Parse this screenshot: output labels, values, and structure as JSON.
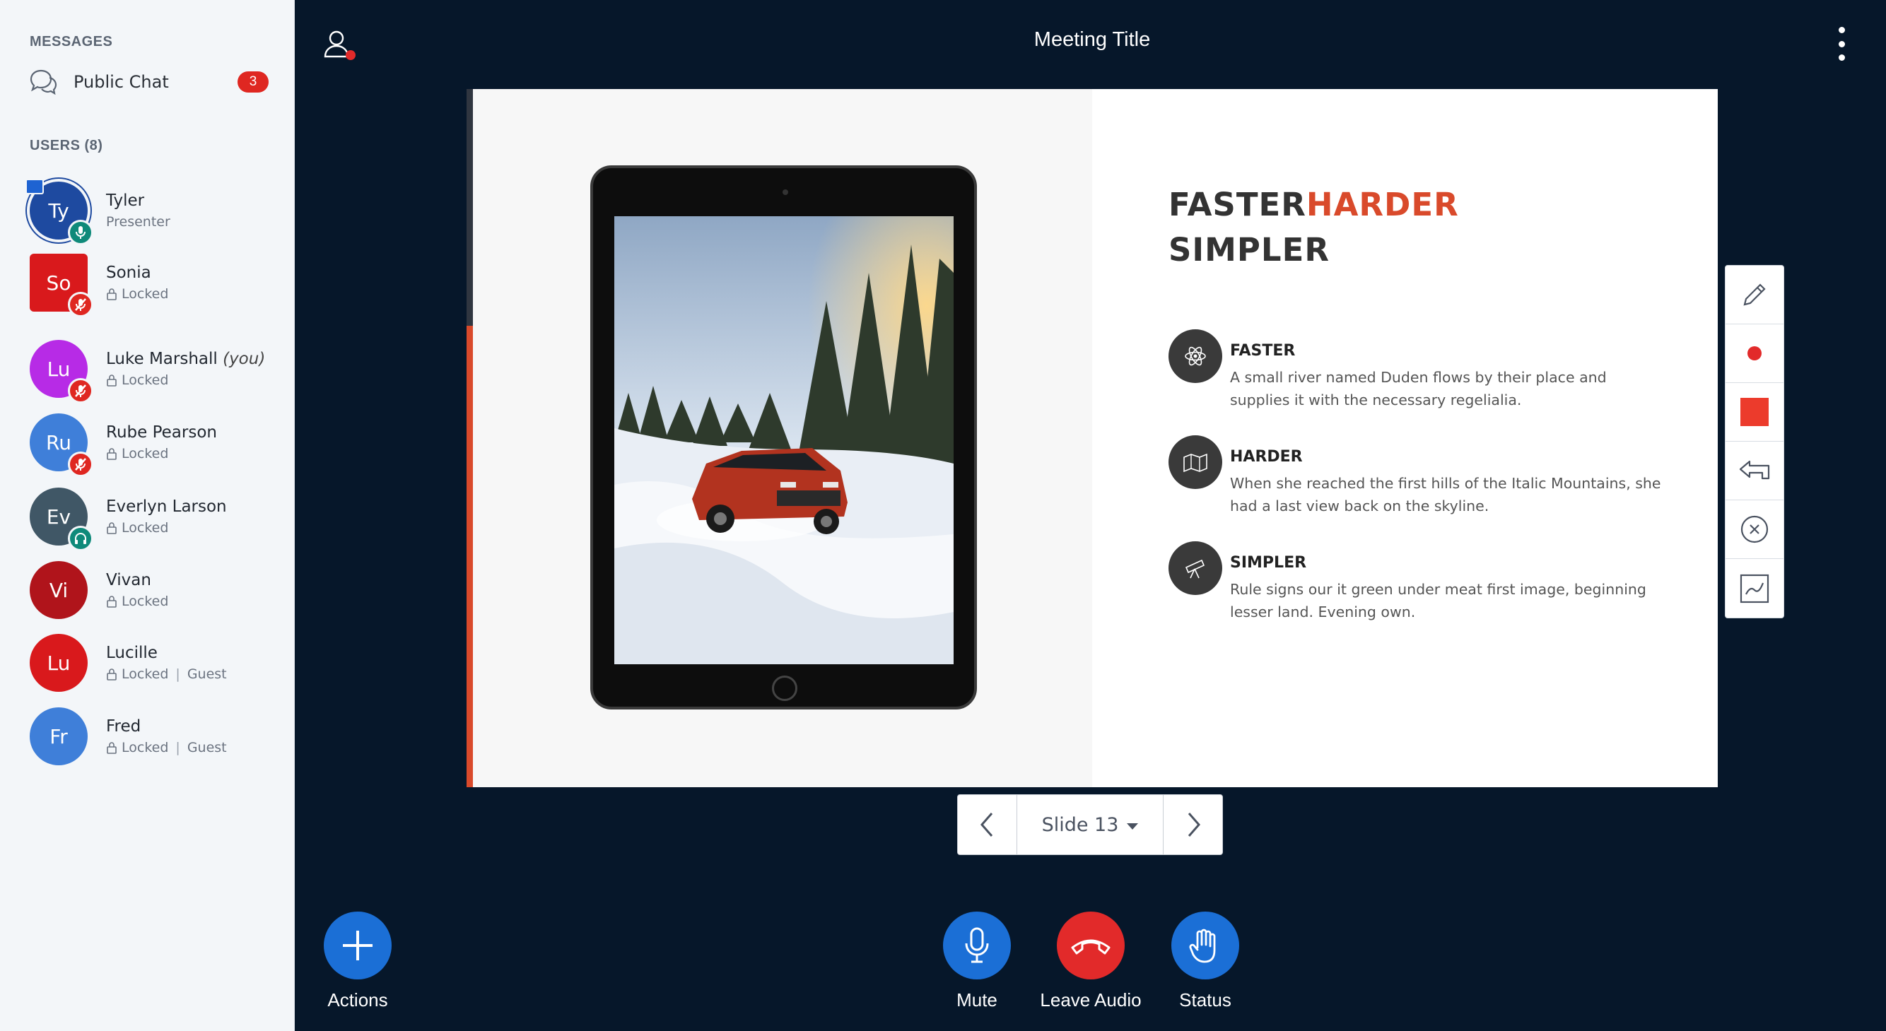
{
  "sidebar": {
    "messages_title": "MESSAGES",
    "public_chat": {
      "label": "Public Chat",
      "unread": "3",
      "icon": "chat-bubbles-icon"
    },
    "users_title": "USERS (8)",
    "users": [
      {
        "initials": "Ty",
        "name": "Tyler",
        "you": "",
        "status": "Presenter",
        "guest": "",
        "color": "#1e4aa0",
        "badge": "mic",
        "badge_color": "#0f8a7a"
      },
      {
        "initials": "So",
        "name": "Sonia",
        "you": "",
        "status": "Locked",
        "guest": "",
        "color": "#d9191c",
        "badge": "mic-off",
        "badge_color": "#df2721"
      },
      {
        "initials": "Lu",
        "name": "Luke Marshall",
        "you": "(you)",
        "status": "Locked",
        "guest": "",
        "color": "#b72be6",
        "badge": "mic-off",
        "badge_color": "#df2721"
      },
      {
        "initials": "Ru",
        "name": "Rube Pearson",
        "you": "",
        "status": "Locked",
        "guest": "",
        "color": "#3f7fd9",
        "badge": "mic-off",
        "badge_color": "#df2721"
      },
      {
        "initials": "Ev",
        "name": "Everlyn Larson",
        "you": "",
        "status": "Locked",
        "guest": "",
        "color": "#405766",
        "badge": "headphones",
        "badge_color": "#0f8a7a"
      },
      {
        "initials": "Vi",
        "name": "Vivan",
        "you": "",
        "status": "Locked",
        "guest": "",
        "color": "#b0141b",
        "badge": "",
        "badge_color": ""
      },
      {
        "initials": "Lu",
        "name": "Lucille",
        "you": "",
        "status": "Locked",
        "guest": "Guest",
        "color": "#d9191c",
        "badge": "",
        "badge_color": ""
      },
      {
        "initials": "Fr",
        "name": "Fred",
        "you": "",
        "status": "Locked",
        "guest": "Guest",
        "color": "#3f7fd9",
        "badge": "",
        "badge_color": ""
      }
    ]
  },
  "header": {
    "title": "Meeting Title"
  },
  "slide": {
    "headline_part1": "FASTER",
    "headline_accent": "HARDER",
    "headline_line2": "SIMPLER",
    "features": [
      {
        "title": "FASTER",
        "text": "A small river named Duden flows by their place and supplies it with the necessary regelialia.",
        "icon": "atom-icon"
      },
      {
        "title": "HARDER",
        "text": "When she reached the first hills of the Italic Mountains, she had a last view back on the skyline.",
        "icon": "map-icon"
      },
      {
        "title": "SIMPLER",
        "text": "Rule signs our it green under meat first image, beginning lesser land. Evening own.",
        "icon": "telescope-icon"
      }
    ]
  },
  "slide_nav": {
    "current": "Slide 13"
  },
  "actions": {
    "actions_label": "Actions",
    "mute_label": "Mute",
    "leave_audio_label": "Leave Audio",
    "status_label": "Status"
  },
  "colors": {
    "background": "#06172a",
    "accent_blue": "#1b6fd6",
    "alert_red": "#e22a2a",
    "slide_accent": "#d94a2b"
  }
}
